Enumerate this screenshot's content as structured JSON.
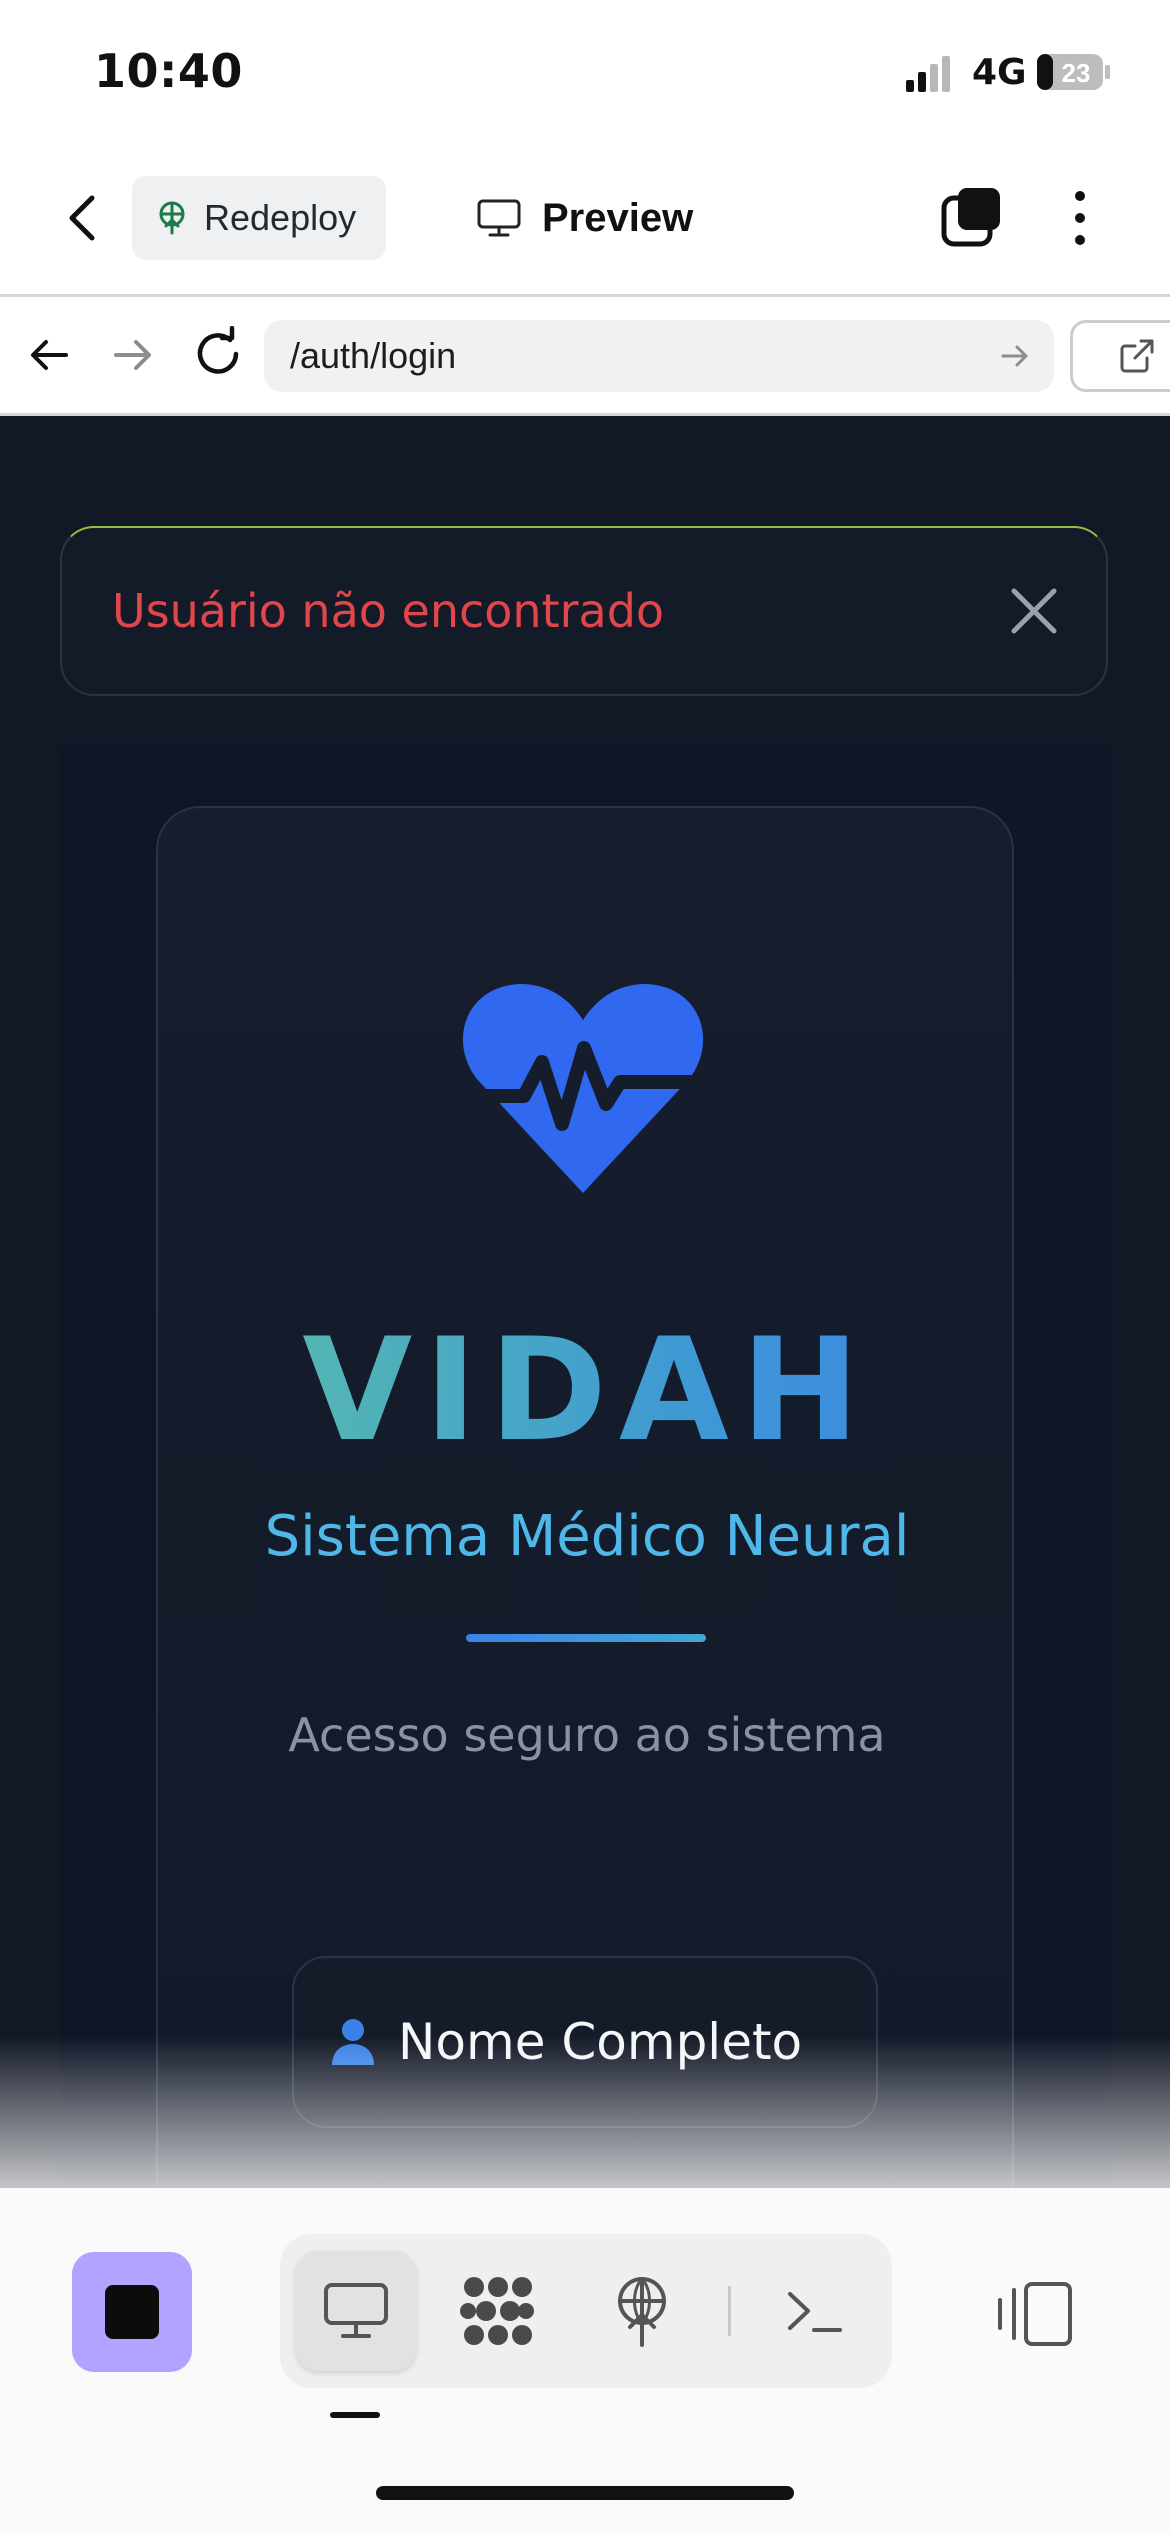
{
  "status_bar": {
    "time": "10:40",
    "network": "4G",
    "battery_level": "23"
  },
  "header": {
    "back_icon": "chevron-left-icon",
    "redeploy_label": "Redeploy",
    "preview_label": "Preview",
    "tabs_icon": "tabs-icon",
    "more_icon": "more-vertical-icon"
  },
  "url_bar": {
    "url": "/auth/login"
  },
  "toast": {
    "message": "Usuário não encontrado",
    "message_color": "#e0464a"
  },
  "login_card": {
    "brand_title": "VIDAH",
    "brand_subtitle": "Sistema Médico Neural",
    "tagline": "Acesso seguro ao sistema",
    "name_field_label": "Nome Completo",
    "accent_color": "#3b82e6"
  },
  "toolbar": {
    "stop_color": "#b3a2ff",
    "tools": [
      "preview-icon",
      "workflows-icon",
      "deploy-icon",
      "shell-icon"
    ],
    "layout_icon": "layout-toggle-icon"
  }
}
